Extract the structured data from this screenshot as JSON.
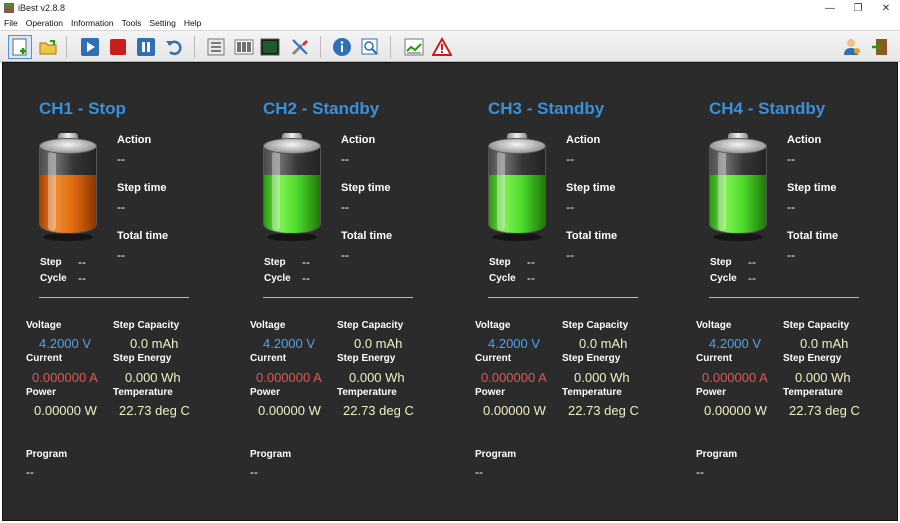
{
  "window": {
    "title": "iBest v2.8.8"
  },
  "menu": [
    "File",
    "Operation",
    "Information",
    "Tools",
    "Setting",
    "Help"
  ],
  "toolbar_icons": [
    "new-file-icon",
    "open-folder-icon",
    "play-icon",
    "stop-icon",
    "pause-icon",
    "undo-icon",
    "settings-list-icon",
    "barcode-icon",
    "terminal-icon",
    "tools-icon",
    "info-icon",
    "zoom-icon",
    "chart-icon",
    "warning-icon",
    "user-icon",
    "exit-icon"
  ],
  "labels": {
    "action": "Action",
    "step_time": "Step time",
    "total_time": "Total time",
    "step": "Step",
    "cycle": "Cycle",
    "voltage": "Voltage",
    "step_capacity": "Step Capacity",
    "current": "Current",
    "step_energy": "Step Energy",
    "power": "Power",
    "temperature": "Temperature",
    "program": "Program"
  },
  "channels": [
    {
      "title": "CH1 - Stop",
      "battery_color": "#e06a10",
      "battery_level": 0.68,
      "action": "--",
      "step_time": "--",
      "total_time": "--",
      "step": "--",
      "cycle": "--",
      "voltage": "4.2000 V",
      "step_capacity": "0.0 mAh",
      "current": "0.000000 A",
      "step_energy": "0.000 Wh",
      "power": "0.00000 W",
      "temperature": "22.73 deg C",
      "program": "--"
    },
    {
      "title": "CH2 - Standby",
      "battery_color": "#4ad82a",
      "battery_level": 0.68,
      "action": "--",
      "step_time": "--",
      "total_time": "--",
      "step": "--",
      "cycle": "--",
      "voltage": "4.2000 V",
      "step_capacity": "0.0 mAh",
      "current": "0.000000 A",
      "step_energy": "0.000 Wh",
      "power": "0.00000 W",
      "temperature": "22.73 deg C",
      "program": "--"
    },
    {
      "title": "CH3 - Standby",
      "battery_color": "#4ad82a",
      "battery_level": 0.68,
      "action": "--",
      "step_time": "--",
      "total_time": "--",
      "step": "--",
      "cycle": "--",
      "voltage": "4.2000 V",
      "step_capacity": "0.0 mAh",
      "current": "0.000000 A",
      "step_energy": "0.000 Wh",
      "power": "0.00000 W",
      "temperature": "22.73 deg C",
      "program": "--"
    },
    {
      "title": "CH4 - Standby",
      "battery_color": "#4ad82a",
      "battery_level": 0.68,
      "action": "--",
      "step_time": "--",
      "total_time": "--",
      "step": "--",
      "cycle": "--",
      "voltage": "4.2000 V",
      "step_capacity": "0.0 mAh",
      "current": "0.000000 A",
      "step_energy": "0.000 Wh",
      "power": "0.00000 W",
      "temperature": "22.73 deg C",
      "program": "--"
    }
  ]
}
